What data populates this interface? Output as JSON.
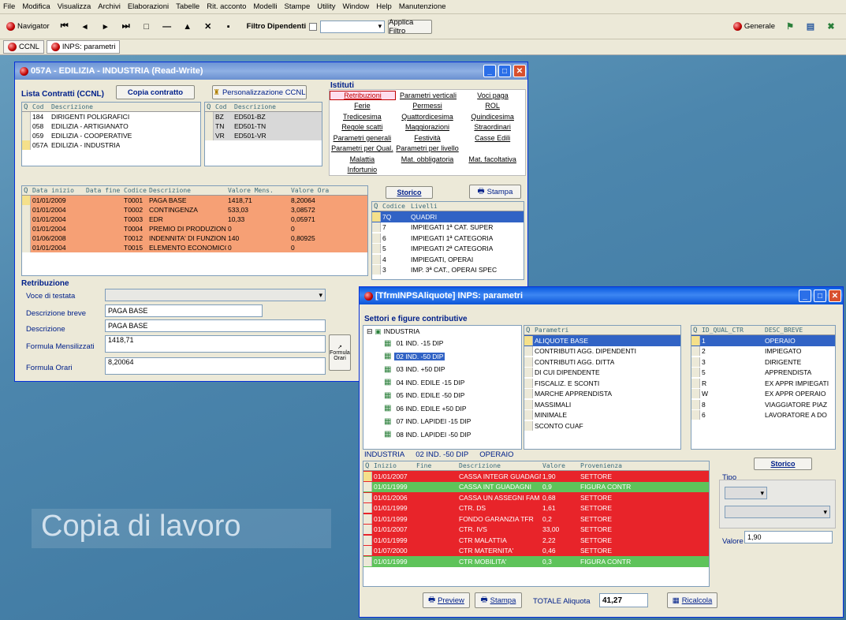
{
  "menu": [
    "File",
    "Modifica",
    "Visualizza",
    "Archivi",
    "Elaborazioni",
    "Tabelle",
    "Rit. acconto",
    "Modelli",
    "Stampe",
    "Utility",
    "Window",
    "Help",
    "Manutenzione"
  ],
  "toolbar": {
    "navigator": "Navigator",
    "filter_label": "Filtro Dipendenti",
    "apply_filter": "Applica Filtro",
    "generale": "Generale"
  },
  "tabs": [
    "CCNL",
    "INPS: parametri"
  ],
  "win1": {
    "title": "057A - EDILIZIA - INDUSTRIA (Read-Write)",
    "lista_label": "Lista Contratti (CCNL)",
    "copia_button": "Copia contratto",
    "pers_button": "Personalizzazione CCNL",
    "contracts_headers": [
      "Cod",
      "Descrizione"
    ],
    "contracts": [
      [
        "184",
        "DIRIGENTI POLIGRAFICI"
      ],
      [
        "058",
        "EDILIZIA - ARTIGIANATO"
      ],
      [
        "059",
        "EDILIZIA - COOPERATIVE"
      ],
      [
        "057A",
        "EDILIZIA - INDUSTRIA"
      ]
    ],
    "regions_headers": [
      "Cod",
      "Descrizione"
    ],
    "regions": [
      [
        "BZ",
        "ED501-BZ"
      ],
      [
        "TN",
        "ED501-TN"
      ],
      [
        "VR",
        "ED501-VR"
      ]
    ],
    "istituti_label": "Istituti",
    "istituti": [
      [
        "Retribuzioni",
        "Parametri verticali",
        "Voci paga"
      ],
      [
        "Ferie",
        "Permessi",
        "ROL"
      ],
      [
        "Tredicesima",
        "Quattordicesima",
        "Quindicesima"
      ],
      [
        "Regole scatti",
        "Maggiorazioni",
        "Straordinari"
      ],
      [
        "Parametri generali",
        "Festività",
        "Casse Edili"
      ],
      [
        "Parametri per Qual.",
        "Parametri per livello",
        ""
      ],
      [
        "Malattia",
        "Mat. obbligatoria",
        "Mat. facoltativa"
      ],
      [
        "Infortunio",
        "",
        ""
      ]
    ],
    "retrib_headers": [
      "Data inizio",
      "Data fine",
      "Codice",
      "Descrizione",
      "Valore Mens.",
      "Valore Ora"
    ],
    "retrib_rows": [
      [
        "01/01/2009",
        "",
        "T0001",
        "PAGA BASE",
        "1418,71",
        "8,20064"
      ],
      [
        "01/01/2004",
        "",
        "T0002",
        "CONTINGENZA",
        "533,03",
        "3,08572"
      ],
      [
        "01/01/2004",
        "",
        "T0003",
        "EDR",
        "10,33",
        "0,05971"
      ],
      [
        "01/01/2004",
        "",
        "T0004",
        "PREMIO DI PRODUZIONE",
        "0",
        "0"
      ],
      [
        "01/06/2008",
        "",
        "T0012",
        "INDENNITA' DI FUNZIONE",
        "140",
        "0,80925"
      ],
      [
        "01/01/2004",
        "",
        "T0015",
        "ELEMENTO ECONOMICO",
        "0",
        "0"
      ]
    ],
    "storico_button": "Storico",
    "stampa_button": "Stampa",
    "livelli_headers": [
      "Codice",
      "Livelli"
    ],
    "livelli": [
      [
        "7Q",
        "QUADRI"
      ],
      [
        "7",
        "IMPIEGATI 1ª CAT. SUPER"
      ],
      [
        "6",
        "IMPIEGATI 1ª CATEGORIA"
      ],
      [
        "5",
        "IMPIEGATI 2ª CATEGORIA"
      ],
      [
        "4",
        "IMPIEGATI, OPERAI"
      ],
      [
        "3",
        "IMP. 3ª CAT., OPERAI SPEC"
      ]
    ],
    "retribuzione_label": "Retribuzione",
    "voce_testata_label": "Voce di testata",
    "desc_breve_label": "Descrizione breve",
    "desc_breve_value": "PAGA BASE",
    "descrizione_label": "Descrizione",
    "descrizione_value": "PAGA BASE",
    "formula_mens_label": "Formula Mensilizzati",
    "formula_mens_value": "1418,71",
    "formula_orari_label": "Formula Orari",
    "formula_orari_value": "8,20064",
    "formula_button": "Formula Orari"
  },
  "watermark": "Copia di lavoro",
  "win2": {
    "title": "[TfrmINPSAliquote] INPS: parametri",
    "settori_label": "Settori e figure contributive",
    "tree_root": "INDUSTRIA",
    "tree": [
      "01 IND. -15 DIP",
      "02 IND. -50 DIP",
      "03 IND. +50 DIP",
      "04 IND. EDILE -15 DIP",
      "05 IND. EDILE -50 DIP",
      "06 IND. EDILE +50 DIP",
      "07 IND. LAPIDEI -15 DIP",
      "08 IND. LAPIDEI -50 DIP"
    ],
    "param_header": "Parametri",
    "parametri": [
      "ALIQUOTE BASE",
      "CONTRIBUTI AGG. DIPENDENTI",
      "CONTRIBUTI AGG. DITTA",
      "DI CUI DIPENDENTE",
      "FISCALIZ. E SCONTI",
      "MARCHE APPRENDISTA",
      "MASSIMALI",
      "MINIMALE",
      "SCONTO CUAF"
    ],
    "qual_headers": [
      "ID_QUAL_CTR",
      "DESC_BREVE"
    ],
    "qual": [
      [
        "1",
        "OPERAIO"
      ],
      [
        "2",
        "IMPIEGATO"
      ],
      [
        "3",
        "DIRIGENTE"
      ],
      [
        "5",
        "APPRENDISTA"
      ],
      [
        "R",
        "EX APPR IMPIEGATI"
      ],
      [
        "W",
        "EX APPR OPERAIO"
      ],
      [
        "8",
        "VIAGGIATORE PIAZ"
      ],
      [
        "6",
        "LAVORATORE A DO"
      ]
    ],
    "path": [
      "INDUSTRIA",
      "02 IND. -50 DIP",
      "OPERAIO"
    ],
    "aliq_headers": [
      "Inizio",
      "Fine",
      "Descrizione",
      "Valore",
      "Provenienza"
    ],
    "aliquote": [
      [
        "01/01/2007",
        "",
        "CASSA INTEGR GUADAGNI",
        "1,90",
        "SETTORE",
        "red"
      ],
      [
        "01/01/1999",
        "",
        "CASSA INT GUADAGNI",
        "0,9",
        "FIGURA CONTR",
        "green"
      ],
      [
        "01/01/2006",
        "",
        "CASSA UN ASSEGNI FAM",
        "0,68",
        "SETTORE",
        "red"
      ],
      [
        "01/01/1999",
        "",
        "CTR. DS",
        "1,61",
        "SETTORE",
        "red"
      ],
      [
        "01/01/1999",
        "",
        "FONDO GARANZIA TFR",
        "0,2",
        "SETTORE",
        "red"
      ],
      [
        "01/01/2007",
        "",
        "CTR. IVS",
        "33,00",
        "SETTORE",
        "red"
      ],
      [
        "01/01/1999",
        "",
        "CTR MALATTIA",
        "2,22",
        "SETTORE",
        "red"
      ],
      [
        "01/07/2000",
        "",
        "CTR MATERNITA'",
        "0,46",
        "SETTORE",
        "red"
      ],
      [
        "01/01/1999",
        "",
        "CTR MOBILITA'",
        "0,3",
        "FIGURA CONTR",
        "green"
      ]
    ],
    "storico_button": "Storico",
    "tipo_label": "Tipo",
    "valore_label": "Valore",
    "valore_value": "1,90",
    "preview_button": "Preview",
    "stampa_button": "Stampa",
    "totale_label": "TOTALE Aliquota",
    "totale_value": "41,27",
    "ricalcola_button": "Ricalcola"
  }
}
